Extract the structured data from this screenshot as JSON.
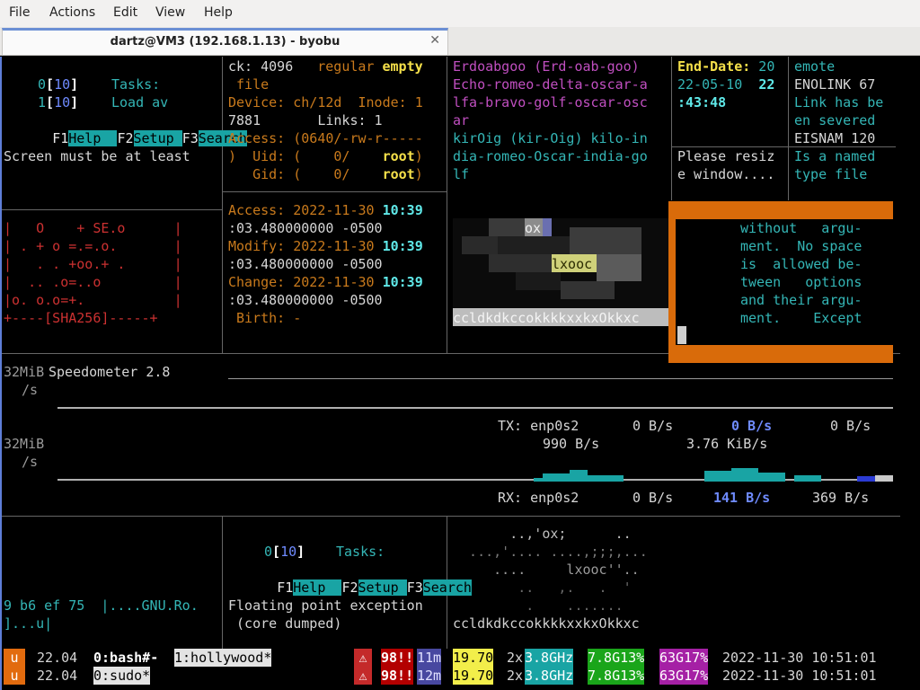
{
  "menubar": {
    "file": "File",
    "actions": "Actions",
    "edit": "Edit",
    "view": "View",
    "help": "Help"
  },
  "tab": {
    "title": "dartz@VM3 (192.168.1.13) - byobu",
    "close": "✕"
  },
  "htop1": {
    "cpu_a": "0",
    "cpu_a_num": "10",
    "tasks": "Tasks:",
    "cpu_b": "1",
    "cpu_b_num": "10",
    "load": "Load av",
    "f1": "F1",
    "f1_label": "Help  ",
    "f2": "F2",
    "f2_label": "Setup ",
    "f3": "F3",
    "f3_label": "Search",
    "screen_msg": "Screen must be at least"
  },
  "sha_art": [
    "|   O    + SE.o      |",
    "| . + o =.=.o.       |",
    "|   . . +oo.+ .      |",
    "|  .. .o=..o         |",
    "|o. o.o=+.           |",
    "+----[SHA256]-----+"
  ],
  "stat": {
    "l1": "ck: 4096",
    "l1b": "regular",
    "l1c": "empty",
    "l2": " file",
    "l3": "Device: ch/12d  Inode: 1",
    "l4": "7881       Links: 1",
    "l5": "Access: (0640/-rw-r-----",
    "l6a": ")  Uid: (    0/    ",
    "l6b": "root",
    "l6c": ")",
    "l7a": "   Gid: (    0/    ",
    "l7b": "root",
    "l7c": ")",
    "l8a": "Access: 2022-11-30 ",
    "l8b": "10:39",
    "l9": ":03.480000000 -0500",
    "l10a": "Modify: 2022-11-30 ",
    "l10b": "10:39",
    "l11": ":03.480000000 -0500",
    "l12a": "Change: 2022-11-30 ",
    "l12b": "10:39",
    "l13": ":03.480000000 -0500",
    "l14": " Birth: -"
  },
  "nato": {
    "l1": "Erdoabgoo (Erd-oab-goo)",
    "l2": "Echo-romeo-delta-oscar-a",
    "l3": "lfa-bravo-golf-oscar-osc",
    "l4": "ar",
    "l5": "kirOig (kir-Oig) kilo-in",
    "l6": "dia-romeo-Oscar-india-go",
    "l7": "lf"
  },
  "enddate": {
    "l1a": "End-Date:",
    "l1b": " 20",
    "l2a": "22-05-10  ",
    "l2b": "22",
    "l3": ":43:48",
    "l5": "Please resiz",
    "l6": "e window...."
  },
  "errno": {
    "l1": "emote",
    "l2": "ENOLINK 67",
    "l3": "Link has be",
    "l4": "en severed",
    "l5": "EISNAM 120",
    "l6": "Is a named",
    "l7": "type file"
  },
  "ascii_top": {
    "ox": "ox",
    "lxooc": "lxooc",
    "bottom": "ccldkdkccokkkkxxkxOkkxc"
  },
  "manpage": [
    "without   argu-",
    "ment.  No space",
    "is  allowed be-",
    "tween   options",
    "and their argu-",
    "ment.    Except"
  ],
  "speed": {
    "title": "Speedometer 2.8",
    "scale1": "32MiB",
    "unit1": "/s",
    "scale2": "32MiB",
    "unit2": "/s",
    "tx_label": "TX: enp0s2",
    "tx_v1": "0 B/s",
    "tx_v2": "0 B/s",
    "tx_v3": "0 B/s",
    "tx_avg": "990 B/s",
    "tx_peak": "3.76 KiB/s",
    "rx_label": "RX: enp0s2",
    "rx_v1": "0 B/s",
    "rx_v2": "141 B/s",
    "rx_v3": "369 B/s"
  },
  "htop2": {
    "cpu_a": "0",
    "cpu_a_num": "10",
    "tasks": "Tasks:",
    "f1": "F1",
    "f1_label": "Help  ",
    "f2": "F2",
    "f2_label": "Setup ",
    "f3": "F3",
    "f3_label": "Search",
    "fpe1": "Floating point exception",
    "fpe2": " (core dumped)"
  },
  "left_bottom": {
    "l1": "9 b6 ef 75  |....GNU.Ro.",
    "l2": "]...u|"
  },
  "ascii_bottom": [
    "       ..,'ox;      ..",
    "  ...,'.... ....,;;;,...",
    "     ....     lxooc''..",
    "        ..   ,.   .  '",
    "         .    .......",
    "ccldkdkccokkkkxxkxOkkxc"
  ],
  "status": {
    "row1": {
      "logo": "u",
      "ver": " 22.04 ",
      "win0": "0:bash#-",
      "win1": "1:hollywood*",
      "alert": "⚠",
      "load": "98!!",
      "uptime": "11m",
      "loadavg": "19.70",
      "cpus": "2x",
      "freq": "3.8GHz",
      "mem": "7.8G13%",
      "disk": "63G17%",
      "datetime": "2022-11-30 10:51:01"
    },
    "row2": {
      "logo": "u",
      "ver": " 22.04 ",
      "win0": "0:sudo*",
      "alert": "⚠",
      "load": "98!!",
      "uptime": "12m",
      "loadavg": "19.70",
      "cpus": "2x",
      "freq": "3.8GHz",
      "mem": "7.8G13%",
      "disk": "63G17%",
      "datetime": "2022-11-30 10:51:01"
    }
  }
}
